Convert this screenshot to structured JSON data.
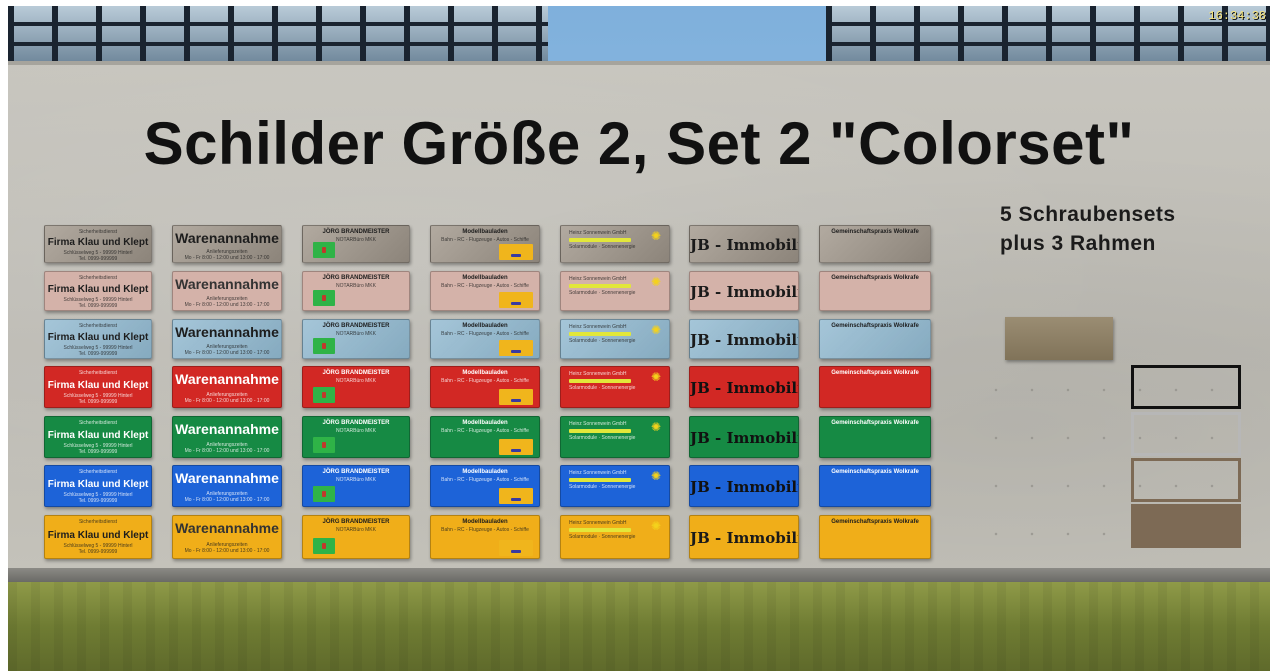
{
  "hud": {
    "clock": "16:34:38"
  },
  "wall": {
    "title": "Schilder Größe 2, Set 2 \"Colorset\"",
    "note_line1": "5 Schraubensets",
    "note_line2": "plus 3 Rahmen"
  },
  "sign_texts": {
    "firma": {
      "small": "Sicherheitsdienst",
      "name": "Firma Klau und Klept",
      "line2": "Schlüsselweg 5 - 99999 Hinterl",
      "line3": "Tel. 0999-999999"
    },
    "waren": {
      "name": "Warenannahme",
      "line2": "Anlieferungszeiten",
      "line3": "Mo - Fr 8:00 - 12:00 und 13:00 - 17:00"
    },
    "joerg": {
      "name": "JÖRG BRANDMEISTER",
      "line2": "NOTARBüro MKK"
    },
    "modell": {
      "name": "Modellbauladen",
      "line2": "Bahn - RC - Flugzeuge - Autos - Schiffe"
    },
    "sonnen": {
      "name": "Heinz Sonnenwein GmbH",
      "line2": "Solarmodule · Sonnenenergie"
    },
    "jb": {
      "name": "JB - Immobilien"
    },
    "gem": {
      "name": "Gemeinschaftspraxis Wolkrafe"
    }
  },
  "color_rows": [
    {
      "name": "weathered",
      "bg": "#a49b8f"
    },
    {
      "name": "pink",
      "bg": "#d4b2a9"
    },
    {
      "name": "light-blue",
      "bg": "#91b9d0"
    },
    {
      "name": "red",
      "bg": "#d22824"
    },
    {
      "name": "green",
      "bg": "#168a44"
    },
    {
      "name": "blue",
      "bg": "#1d63d8"
    },
    {
      "name": "yellow",
      "bg": "#f0ae19"
    }
  ],
  "accents": {
    "joerg_green": "#2fb347",
    "modell_yellow": "#f0b51c",
    "sonnen_stripe": "#e2e73a",
    "frame_black": "#111111",
    "frame_silver": "#b7b7b7",
    "frame_bronze": "#7d6a55",
    "plate_bronze": "#8f8063"
  }
}
